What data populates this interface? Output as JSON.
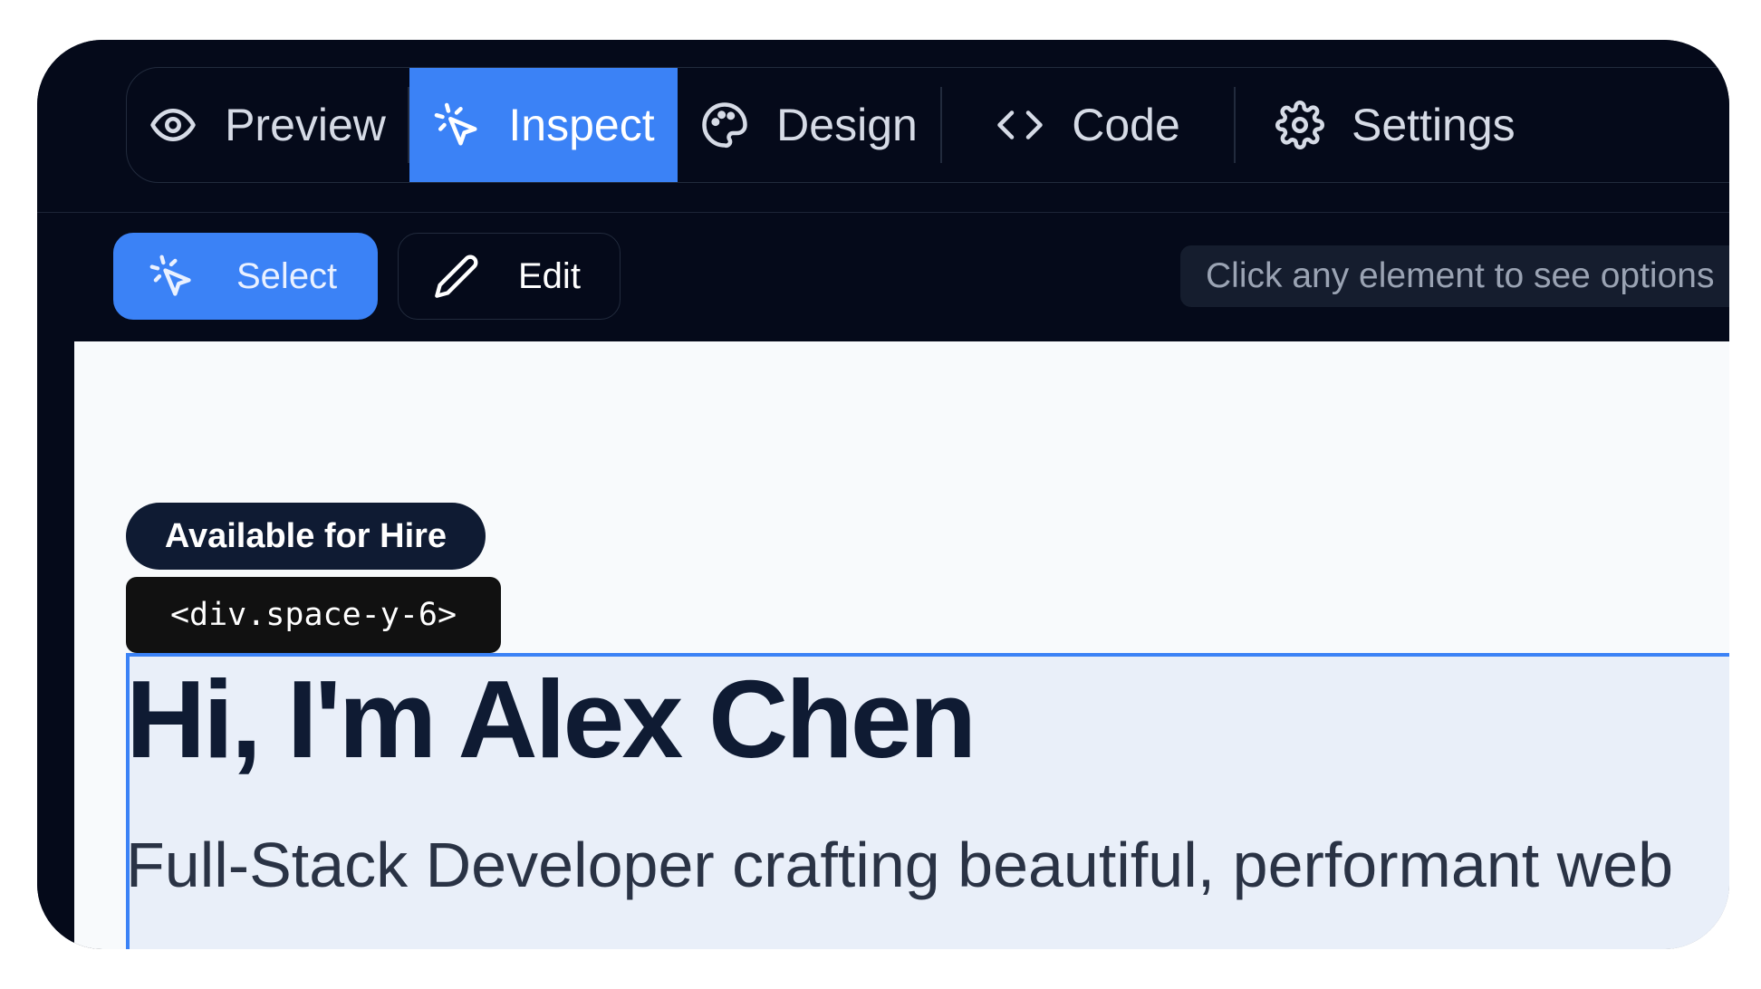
{
  "tabs": [
    {
      "label": "Preview",
      "icon": "eye-icon",
      "active": false
    },
    {
      "label": "Inspect",
      "icon": "cursor-click-icon",
      "active": true
    },
    {
      "label": "Design",
      "icon": "palette-icon",
      "active": false
    },
    {
      "label": "Code",
      "icon": "code-brackets-icon",
      "active": false
    },
    {
      "label": "Settings",
      "icon": "gear-icon",
      "active": false
    }
  ],
  "toolbar": {
    "select_label": "Select",
    "edit_label": "Edit",
    "hint": "Click any element to see options"
  },
  "canvas": {
    "badge": "Available for Hire",
    "element_tag": "<div.space-y-6>",
    "title": "Hi, I'm Alex Chen",
    "subtitle": "Full-Stack Developer crafting beautiful, performant web"
  },
  "colors": {
    "accent": "#3b82f6",
    "app_background": "#050a1a",
    "canvas_background": "#f8fafc",
    "heading": "#0f1b33"
  }
}
